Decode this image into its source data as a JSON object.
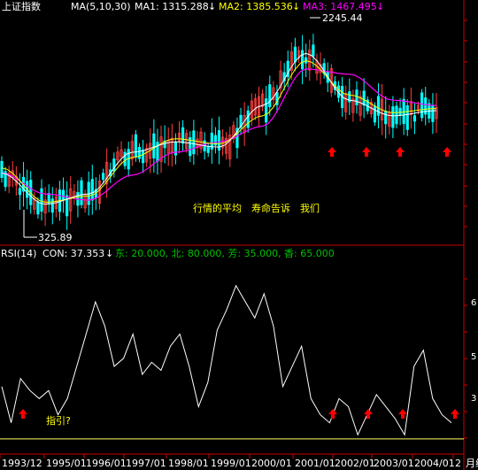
{
  "header": {
    "index_name": "上证指数",
    "ma_label": "MA(5,10,30)",
    "ma1": {
      "label": "MA1: 1315.288",
      "arrow": "↓",
      "color": "#ffffff"
    },
    "ma2": {
      "label": "MA2: 1385.536",
      "arrow": "↓",
      "color": "#ffff00"
    },
    "ma3": {
      "label": "MA3: 1467.495",
      "arrow": "↓",
      "color": "#ff00ff"
    }
  },
  "annotations": {
    "high_label": "2245.44",
    "low_label": "325.89",
    "main_caption": "行情的平均　寿命告诉　我们",
    "rsi_caption": "指引?"
  },
  "rsi_header": {
    "label": "RSI(14)",
    "con": "CON: 37.353",
    "arrow": "↓",
    "params": "东: 20.000, 北: 80.000, 芳: 35.000, 香: 65.000"
  },
  "x_axis": {
    "labels": [
      "1993/12",
      "1995/01",
      "1996/01",
      "1997/01",
      "1998/01",
      "1999/01",
      "2000/01",
      "2001/01",
      "2002/01",
      "2003/01",
      "2004/01",
      "2",
      "月线"
    ]
  },
  "y_axis_rsi_labels": [
    "6",
    "5",
    "3"
  ],
  "colors": {
    "background": "#000000",
    "axis": "#cc0000",
    "candle_up": "#ff4040",
    "candle_down": "#00ffff",
    "ma1": "#ffffff",
    "ma2": "#ffff00",
    "ma3": "#ff00ff",
    "rsi_line": "#ffffff",
    "caption": "#ffff00",
    "params": "#00c000",
    "arrow_marker": "#ff0000"
  },
  "chart_data": {
    "type": "line",
    "title": "上证指数",
    "x": [
      "1993/12",
      "1995/01",
      "1996/01",
      "1997/01",
      "1998/01",
      "1999/01",
      "2000/01",
      "2001/01",
      "2002/01",
      "2003/01",
      "2004/01"
    ],
    "price_series": [
      {
        "name": "MA1",
        "values": [
          900,
          600,
          700,
          1100,
          1200,
          1150,
          1550,
          2050,
          1600,
          1450,
          1500
        ]
      },
      {
        "name": "MA2",
        "values": [
          950,
          620,
          680,
          1050,
          1230,
          1180,
          1450,
          1980,
          1650,
          1480,
          1520
        ]
      },
      {
        "name": "MA3",
        "values": [
          900,
          700,
          640,
          880,
          1100,
          1200,
          1350,
          1900,
          1850,
          1600,
          1550
        ]
      }
    ],
    "price_extremes": {
      "high": 2245.44,
      "low": 325.89
    },
    "rsi": {
      "name": "RSI(14)",
      "values": [
        45,
        36,
        47,
        44,
        42,
        44,
        38,
        42,
        50,
        58,
        66,
        60,
        50,
        52,
        58,
        48,
        51,
        49,
        55,
        58,
        50,
        40,
        46,
        59,
        64,
        70,
        66,
        62,
        68,
        60,
        45,
        50,
        55,
        42,
        38,
        36,
        42,
        40,
        33,
        38,
        43,
        40,
        37,
        33,
        50,
        54,
        42,
        38,
        36
      ],
      "ylim": [
        30,
        75
      ],
      "baseline": 32
    },
    "buy_arrows_price_panel": [
      "2001/10",
      "2002/10",
      "2003/06",
      "2004/06"
    ],
    "buy_arrows_rsi_panel": [
      "1994/01",
      "2001/10",
      "2002/10",
      "2003/06",
      "2004/06"
    ]
  }
}
